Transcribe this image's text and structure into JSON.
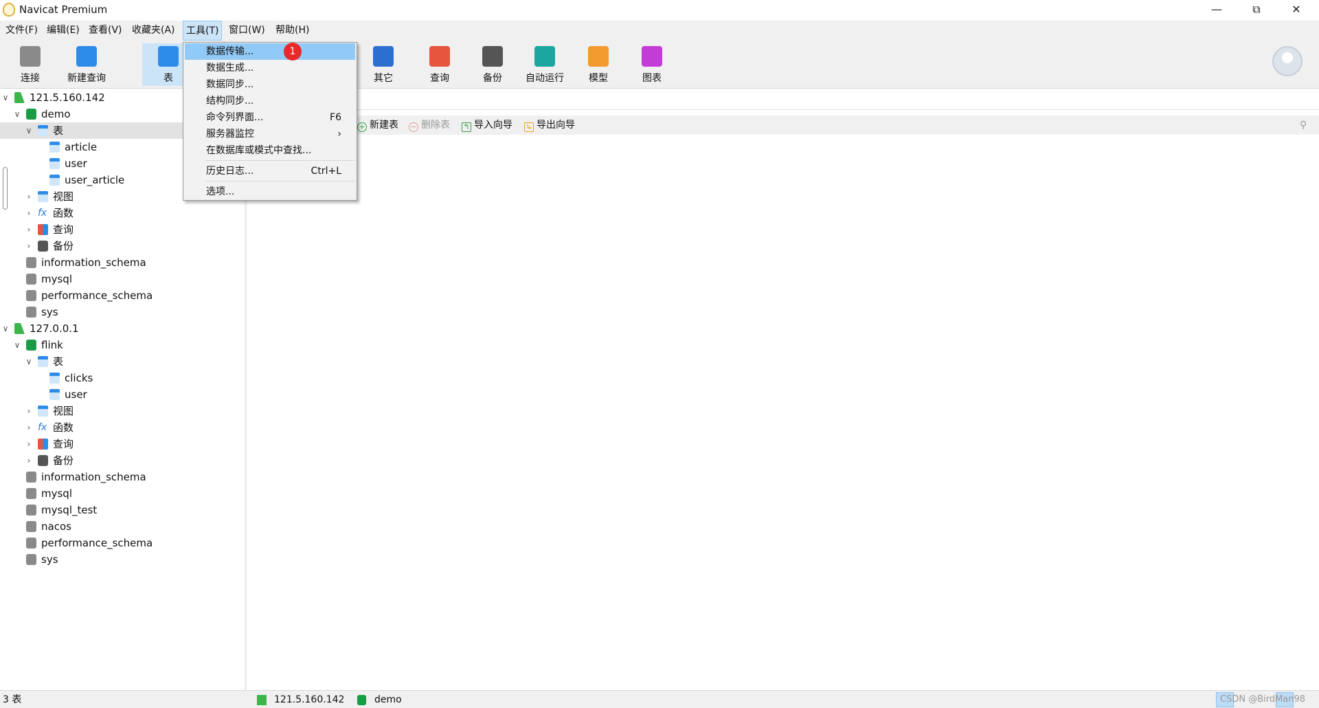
{
  "window": {
    "title": "Navicat Premium",
    "controls": [
      "minimize",
      "restore",
      "close"
    ]
  },
  "menubar": [
    "文件(F)",
    "编辑(E)",
    "查看(V)",
    "收藏夹(A)",
    "工具(T)",
    "窗口(W)",
    "帮助(H)"
  ],
  "toolbar": [
    {
      "label": "连接",
      "icon": "connection-plug-icon",
      "color": "#8a8a8a"
    },
    {
      "label": "新建查询",
      "icon": "new-query-icon",
      "color": "#2d8ce8"
    },
    {
      "label": "表",
      "icon": "table-icon",
      "color": "#2d8ce8",
      "selected": true
    },
    {
      "label": "其它",
      "icon": "tools-icon",
      "color": "#2d6fd0"
    },
    {
      "label": "查询",
      "icon": "query-icon",
      "color": "#e8553e"
    },
    {
      "label": "备份",
      "icon": "backup-icon",
      "color": "#555555"
    },
    {
      "label": "自动运行",
      "icon": "robot-icon",
      "color": "#1ba7a0"
    },
    {
      "label": "模型",
      "icon": "model-icon",
      "color": "#f29a2e"
    },
    {
      "label": "图表",
      "icon": "chart-icon",
      "color": "#c43cd8"
    }
  ],
  "tree": [
    {
      "label": "121.5.160.142",
      "level": 0,
      "icon": "conn",
      "exp": "open"
    },
    {
      "label": "demo",
      "level": 1,
      "icon": "db-g",
      "exp": "open"
    },
    {
      "label": "表",
      "level": 2,
      "icon": "tbl",
      "exp": "open",
      "selected": true
    },
    {
      "label": "article",
      "level": 3,
      "icon": "tbl"
    },
    {
      "label": "user",
      "level": 3,
      "icon": "tbl"
    },
    {
      "label": "user_article",
      "level": 3,
      "icon": "tbl"
    },
    {
      "label": "视图",
      "level": 2,
      "icon": "view",
      "exp": "closed"
    },
    {
      "label": "函数",
      "level": 2,
      "icon": "func",
      "exp": "closed"
    },
    {
      "label": "查询",
      "level": 2,
      "icon": "query",
      "exp": "closed"
    },
    {
      "label": "备份",
      "level": 2,
      "icon": "backup",
      "exp": "closed"
    },
    {
      "label": "information_schema",
      "level": 1,
      "icon": "db"
    },
    {
      "label": "mysql",
      "level": 1,
      "icon": "db"
    },
    {
      "label": "performance_schema",
      "level": 1,
      "icon": "db"
    },
    {
      "label": "sys",
      "level": 1,
      "icon": "db"
    },
    {
      "label": "127.0.0.1",
      "level": 0,
      "icon": "conn",
      "exp": "open"
    },
    {
      "label": "flink",
      "level": 1,
      "icon": "db-g",
      "exp": "open"
    },
    {
      "label": "表",
      "level": 2,
      "icon": "tbl",
      "exp": "open"
    },
    {
      "label": "clicks",
      "level": 3,
      "icon": "tbl"
    },
    {
      "label": "user",
      "level": 3,
      "icon": "tbl"
    },
    {
      "label": "视图",
      "level": 2,
      "icon": "view",
      "exp": "closed"
    },
    {
      "label": "函数",
      "level": 2,
      "icon": "func",
      "exp": "closed"
    },
    {
      "label": "查询",
      "level": 2,
      "icon": "query",
      "exp": "closed"
    },
    {
      "label": "备份",
      "level": 2,
      "icon": "backup",
      "exp": "closed"
    },
    {
      "label": "information_schema",
      "level": 1,
      "icon": "db"
    },
    {
      "label": "mysql",
      "level": 1,
      "icon": "db"
    },
    {
      "label": "mysql_test",
      "level": 1,
      "icon": "db"
    },
    {
      "label": "nacos",
      "level": 1,
      "icon": "db"
    },
    {
      "label": "performance_schema",
      "level": 1,
      "icon": "db"
    },
    {
      "label": "sys",
      "level": 1,
      "icon": "db"
    }
  ],
  "objbar": {
    "new_table": "新建表",
    "delete_table": "删除表",
    "import_wizard": "导入向导",
    "export_wizard": "导出向导"
  },
  "tools_menu": {
    "items": [
      {
        "label": "数据传输...",
        "shortcut": "",
        "highlighted": true
      },
      {
        "label": "数据生成...",
        "shortcut": ""
      },
      {
        "label": "数据同步...",
        "shortcut": ""
      },
      {
        "label": "结构同步...",
        "shortcut": ""
      },
      {
        "label": "命令列界面...",
        "shortcut": "F6"
      },
      {
        "label": "服务器监控",
        "shortcut": "›"
      },
      {
        "label": "在数据库或模式中查找...",
        "shortcut": ""
      },
      {
        "label": "历史日志...",
        "shortcut": "Ctrl+L"
      },
      {
        "label": "选项...",
        "shortcut": ""
      }
    ],
    "badge": "1"
  },
  "statusbar": {
    "count": "3 表",
    "connection": "121.5.160.142",
    "database": "demo",
    "watermark": "CSDN @BirdMan98"
  }
}
